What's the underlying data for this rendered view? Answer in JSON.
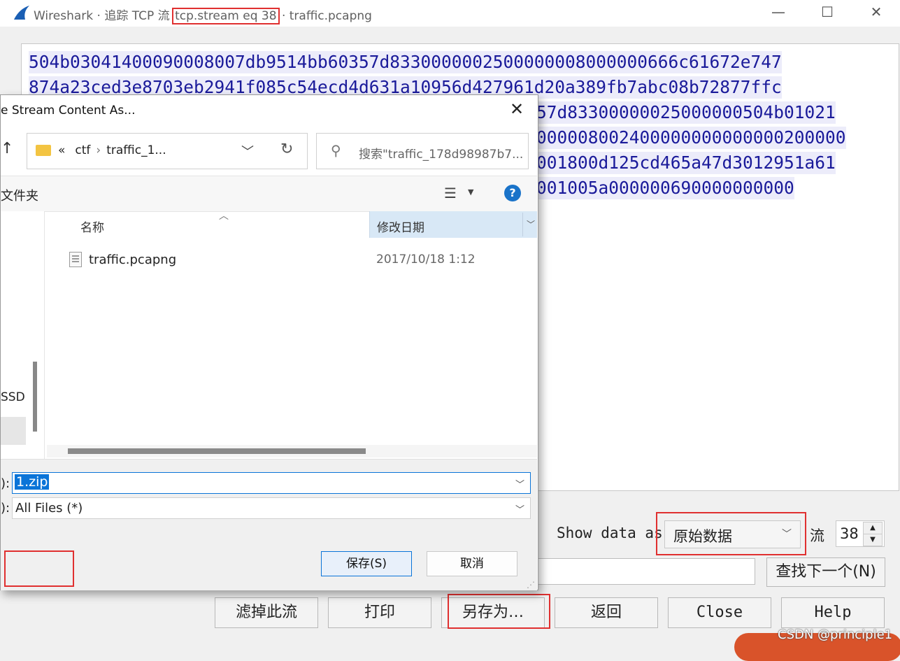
{
  "main": {
    "title": "Wireshark · 追踪 TCP 流 ",
    "title_filter": "tcp.stream eq 38",
    "title_file": " · traffic.pcapng",
    "window_controls": [
      "—",
      "☐",
      "✕"
    ],
    "hex_lines": [
      "504b0304140009000800 7db9514bb60357d8330000002500000008000000666c61672e747",
      "874a23ced3e8703eb2941f085c54ecd4d631a10956d427961d20a389fb7abc08b72877ffc",
      "57d83300000025000000504b01021",
      "000008002400000000000000200000",
      "001800d125cd465a47d3012951a61",
      "001005a000000690000000000"
    ],
    "show_data_label": "Show data as",
    "show_data_value": "原始数据",
    "stream_label": "流",
    "stream_value": "38",
    "find_next": "查找下一个(N)",
    "buttons": {
      "filter_out": "滤掉此流",
      "print": "打印",
      "save_as": "另存为…",
      "back": "返回",
      "close": "Close",
      "help": "Help"
    },
    "watermark": "CSDN @principle1"
  },
  "dialog": {
    "title": "e Stream Content As...",
    "address": [
      "«",
      "ctf",
      "traffic_1..."
    ],
    "search_placeholder": "搜索\"traffic_178d98987b7...",
    "new_folder": "文件夹",
    "nav_ssd": "SSD",
    "columns": {
      "name": "名称",
      "date": "修改日期"
    },
    "files": [
      {
        "name": "traffic.pcapng",
        "date": "2017/10/18 1:12"
      }
    ],
    "filename_label": "):",
    "filename_value": "1.zip",
    "filetype_label": "):",
    "filetype_value": "All Files (*)",
    "save": "保存(S)",
    "cancel": "取消"
  },
  "colors": {
    "highlight": "#e03030",
    "hex_text": "#1a1a9a",
    "accent": "#0a74d8"
  },
  "icons": [
    "wireshark-fin-icon",
    "close-icon",
    "maximize-icon",
    "minimize-icon",
    "folder-icon",
    "refresh-icon",
    "search-icon",
    "view-icon",
    "help-icon",
    "file-icon",
    "chevron-down-icon",
    "up-arrow-icon"
  ]
}
